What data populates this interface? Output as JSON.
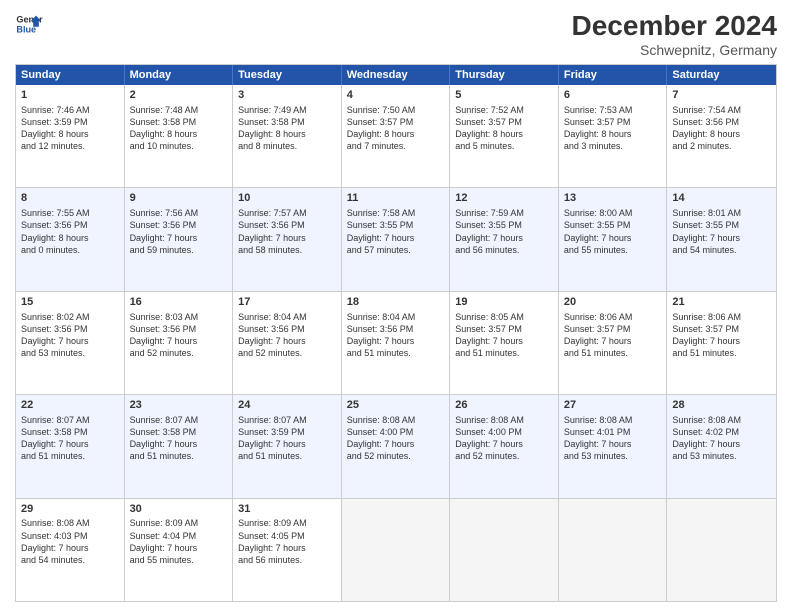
{
  "header": {
    "logo_line1": "General",
    "logo_line2": "Blue",
    "month": "December 2024",
    "location": "Schwepnitz, Germany"
  },
  "weekdays": [
    "Sunday",
    "Monday",
    "Tuesday",
    "Wednesday",
    "Thursday",
    "Friday",
    "Saturday"
  ],
  "rows": [
    [
      {
        "day": "1",
        "lines": [
          "Sunrise: 7:46 AM",
          "Sunset: 3:59 PM",
          "Daylight: 8 hours",
          "and 12 minutes."
        ]
      },
      {
        "day": "2",
        "lines": [
          "Sunrise: 7:48 AM",
          "Sunset: 3:58 PM",
          "Daylight: 8 hours",
          "and 10 minutes."
        ]
      },
      {
        "day": "3",
        "lines": [
          "Sunrise: 7:49 AM",
          "Sunset: 3:58 PM",
          "Daylight: 8 hours",
          "and 8 minutes."
        ]
      },
      {
        "day": "4",
        "lines": [
          "Sunrise: 7:50 AM",
          "Sunset: 3:57 PM",
          "Daylight: 8 hours",
          "and 7 minutes."
        ]
      },
      {
        "day": "5",
        "lines": [
          "Sunrise: 7:52 AM",
          "Sunset: 3:57 PM",
          "Daylight: 8 hours",
          "and 5 minutes."
        ]
      },
      {
        "day": "6",
        "lines": [
          "Sunrise: 7:53 AM",
          "Sunset: 3:57 PM",
          "Daylight: 8 hours",
          "and 3 minutes."
        ]
      },
      {
        "day": "7",
        "lines": [
          "Sunrise: 7:54 AM",
          "Sunset: 3:56 PM",
          "Daylight: 8 hours",
          "and 2 minutes."
        ]
      }
    ],
    [
      {
        "day": "8",
        "lines": [
          "Sunrise: 7:55 AM",
          "Sunset: 3:56 PM",
          "Daylight: 8 hours",
          "and 0 minutes."
        ]
      },
      {
        "day": "9",
        "lines": [
          "Sunrise: 7:56 AM",
          "Sunset: 3:56 PM",
          "Daylight: 7 hours",
          "and 59 minutes."
        ]
      },
      {
        "day": "10",
        "lines": [
          "Sunrise: 7:57 AM",
          "Sunset: 3:56 PM",
          "Daylight: 7 hours",
          "and 58 minutes."
        ]
      },
      {
        "day": "11",
        "lines": [
          "Sunrise: 7:58 AM",
          "Sunset: 3:55 PM",
          "Daylight: 7 hours",
          "and 57 minutes."
        ]
      },
      {
        "day": "12",
        "lines": [
          "Sunrise: 7:59 AM",
          "Sunset: 3:55 PM",
          "Daylight: 7 hours",
          "and 56 minutes."
        ]
      },
      {
        "day": "13",
        "lines": [
          "Sunrise: 8:00 AM",
          "Sunset: 3:55 PM",
          "Daylight: 7 hours",
          "and 55 minutes."
        ]
      },
      {
        "day": "14",
        "lines": [
          "Sunrise: 8:01 AM",
          "Sunset: 3:55 PM",
          "Daylight: 7 hours",
          "and 54 minutes."
        ]
      }
    ],
    [
      {
        "day": "15",
        "lines": [
          "Sunrise: 8:02 AM",
          "Sunset: 3:56 PM",
          "Daylight: 7 hours",
          "and 53 minutes."
        ]
      },
      {
        "day": "16",
        "lines": [
          "Sunrise: 8:03 AM",
          "Sunset: 3:56 PM",
          "Daylight: 7 hours",
          "and 52 minutes."
        ]
      },
      {
        "day": "17",
        "lines": [
          "Sunrise: 8:04 AM",
          "Sunset: 3:56 PM",
          "Daylight: 7 hours",
          "and 52 minutes."
        ]
      },
      {
        "day": "18",
        "lines": [
          "Sunrise: 8:04 AM",
          "Sunset: 3:56 PM",
          "Daylight: 7 hours",
          "and 51 minutes."
        ]
      },
      {
        "day": "19",
        "lines": [
          "Sunrise: 8:05 AM",
          "Sunset: 3:57 PM",
          "Daylight: 7 hours",
          "and 51 minutes."
        ]
      },
      {
        "day": "20",
        "lines": [
          "Sunrise: 8:06 AM",
          "Sunset: 3:57 PM",
          "Daylight: 7 hours",
          "and 51 minutes."
        ]
      },
      {
        "day": "21",
        "lines": [
          "Sunrise: 8:06 AM",
          "Sunset: 3:57 PM",
          "Daylight: 7 hours",
          "and 51 minutes."
        ]
      }
    ],
    [
      {
        "day": "22",
        "lines": [
          "Sunrise: 8:07 AM",
          "Sunset: 3:58 PM",
          "Daylight: 7 hours",
          "and 51 minutes."
        ]
      },
      {
        "day": "23",
        "lines": [
          "Sunrise: 8:07 AM",
          "Sunset: 3:58 PM",
          "Daylight: 7 hours",
          "and 51 minutes."
        ]
      },
      {
        "day": "24",
        "lines": [
          "Sunrise: 8:07 AM",
          "Sunset: 3:59 PM",
          "Daylight: 7 hours",
          "and 51 minutes."
        ]
      },
      {
        "day": "25",
        "lines": [
          "Sunrise: 8:08 AM",
          "Sunset: 4:00 PM",
          "Daylight: 7 hours",
          "and 52 minutes."
        ]
      },
      {
        "day": "26",
        "lines": [
          "Sunrise: 8:08 AM",
          "Sunset: 4:00 PM",
          "Daylight: 7 hours",
          "and 52 minutes."
        ]
      },
      {
        "day": "27",
        "lines": [
          "Sunrise: 8:08 AM",
          "Sunset: 4:01 PM",
          "Daylight: 7 hours",
          "and 53 minutes."
        ]
      },
      {
        "day": "28",
        "lines": [
          "Sunrise: 8:08 AM",
          "Sunset: 4:02 PM",
          "Daylight: 7 hours",
          "and 53 minutes."
        ]
      }
    ],
    [
      {
        "day": "29",
        "lines": [
          "Sunrise: 8:08 AM",
          "Sunset: 4:03 PM",
          "Daylight: 7 hours",
          "and 54 minutes."
        ]
      },
      {
        "day": "30",
        "lines": [
          "Sunrise: 8:09 AM",
          "Sunset: 4:04 PM",
          "Daylight: 7 hours",
          "and 55 minutes."
        ]
      },
      {
        "day": "31",
        "lines": [
          "Sunrise: 8:09 AM",
          "Sunset: 4:05 PM",
          "Daylight: 7 hours",
          "and 56 minutes."
        ]
      },
      {
        "day": "",
        "lines": []
      },
      {
        "day": "",
        "lines": []
      },
      {
        "day": "",
        "lines": []
      },
      {
        "day": "",
        "lines": []
      }
    ]
  ]
}
